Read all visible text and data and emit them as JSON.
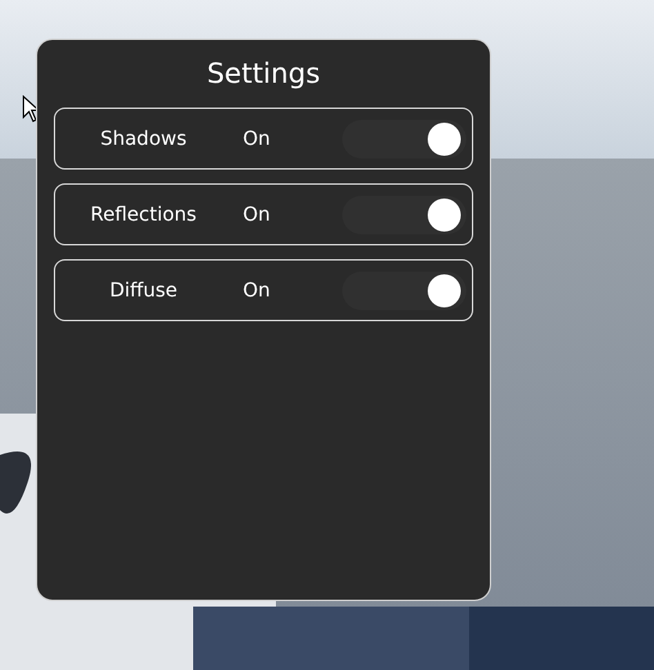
{
  "panel": {
    "title": "Settings"
  },
  "settings": [
    {
      "label": "Shadows",
      "value": "On",
      "on": true
    },
    {
      "label": "Reflections",
      "value": "On",
      "on": true
    },
    {
      "label": "Diffuse",
      "value": "On",
      "on": true
    }
  ]
}
